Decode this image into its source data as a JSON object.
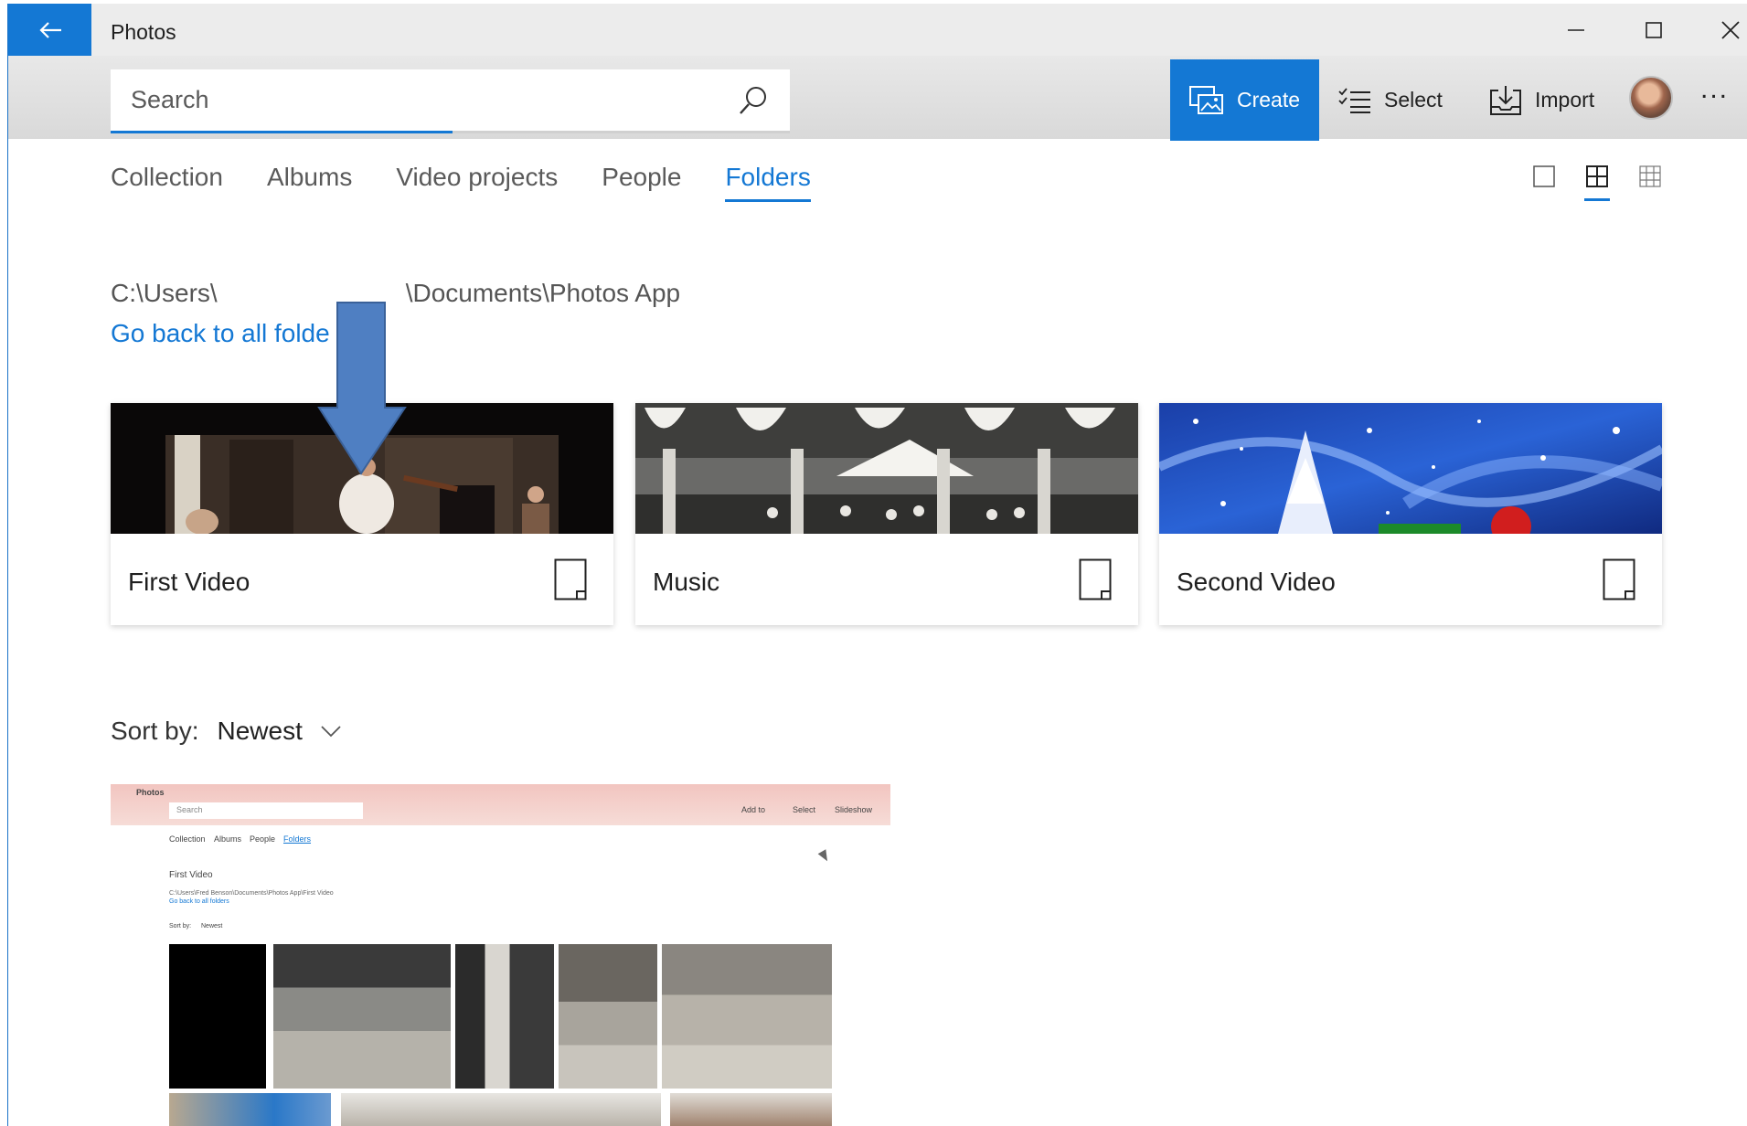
{
  "window": {
    "title": "Photos",
    "accent": "#1478d4"
  },
  "search": {
    "placeholder": "Search"
  },
  "toolbar": {
    "create_label": "Create",
    "select_label": "Select",
    "import_label": "Import",
    "more_label": "..."
  },
  "tabs": [
    {
      "label": "Collection",
      "active": false
    },
    {
      "label": "Albums",
      "active": false
    },
    {
      "label": "Video projects",
      "active": false
    },
    {
      "label": "People",
      "active": false
    },
    {
      "label": "Folders",
      "active": true
    }
  ],
  "path": {
    "prefix": "C:\\Users\\",
    "suffix": "\\Documents\\Photos App",
    "back_link": "Go back to all folde"
  },
  "folders": [
    {
      "name": "First Video"
    },
    {
      "name": "Music"
    },
    {
      "name": "Second Video"
    }
  ],
  "sort": {
    "label": "Sort by:",
    "value": "Newest"
  },
  "video_thumb": {
    "app_title": "Photos",
    "search_placeholder": "Search",
    "tabs": [
      "Collection",
      "Albums",
      "People",
      "Folders"
    ],
    "folder_title": "First Video",
    "path": "C:\\Users\\Fred Benson\\Documents\\Photos App\\First Video",
    "back_link": "Go back to all folders",
    "sort_label": "Sort by:",
    "sort_value": "Newest",
    "toolbar": [
      "Add to",
      "Select",
      "Slideshow"
    ]
  }
}
